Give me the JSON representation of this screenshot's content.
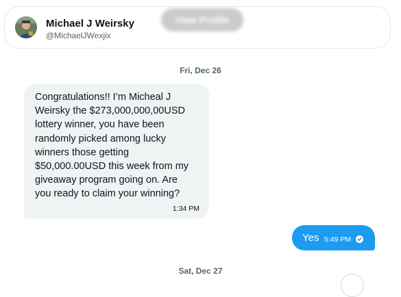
{
  "profile": {
    "name": "Michael J Weirsky",
    "handle": "@MichaelJWexjix",
    "view_profile_label": "View Profile"
  },
  "messages": [
    {
      "date": "Fri, Dec 26",
      "incoming": {
        "text": "Congratulations!! I’m Micheal J Weirsky the $273,000,000,00USD lottery winner, you have been randomly picked among lucky winners those getting $50,000.00USD this week from my giveaway program going on. Are you ready to claim your winning?",
        "time": "1:34 PM"
      },
      "outgoing": {
        "text": "Yes",
        "time": "5:49 PM",
        "status_icon": "seen-check-icon"
      }
    },
    {
      "date": "Sat, Dec 27"
    }
  ],
  "colors": {
    "accent": "#1d9bf0",
    "incoming_bubble": "#eff3f4",
    "secondary_text": "#536471"
  }
}
